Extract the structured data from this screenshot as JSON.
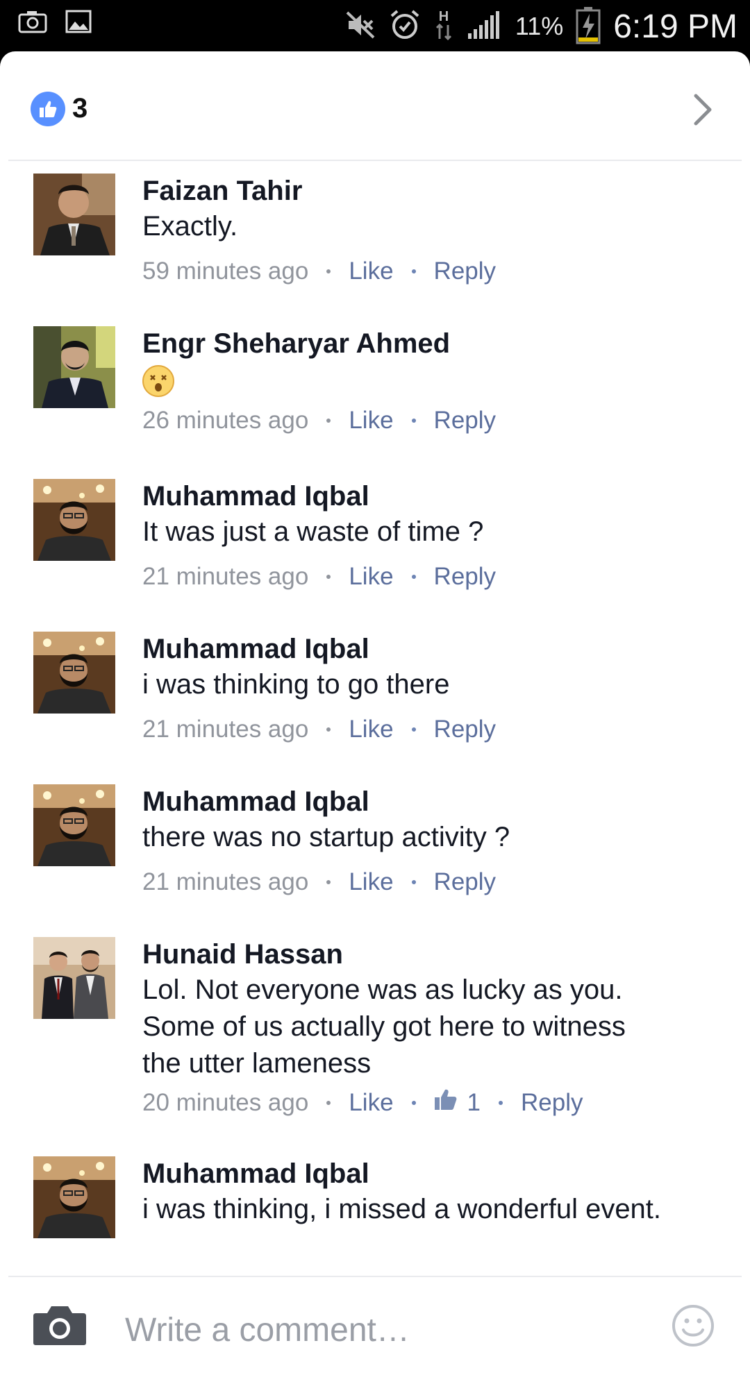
{
  "status_bar": {
    "left_icons": [
      "camera-icon",
      "gallery-icon"
    ],
    "right_icons": [
      "mute-icon",
      "alarm-icon",
      "hspa-data-icon",
      "signal-icon",
      "battery-charging-icon"
    ],
    "battery_pct": "11%",
    "time": "6:19 PM"
  },
  "likes": {
    "icon": "thumbs-up-icon",
    "count": "3",
    "accent": "#5890ff"
  },
  "comments": [
    {
      "name": "Faizan Tahir",
      "text": "Exactly.",
      "time": "59 minutes ago",
      "like": "Like",
      "reply": "Reply"
    },
    {
      "name": "Engr Sheharyar Ahmed",
      "emoji": "dizzy-face-emoji",
      "time": "26 minutes ago",
      "like": "Like",
      "reply": "Reply"
    },
    {
      "name": "Muhammad Iqbal",
      "text": "It was just a waste of time ?",
      "time": "21 minutes ago",
      "like": "Like",
      "reply": "Reply"
    },
    {
      "name": "Muhammad Iqbal",
      "text": "i was thinking to go there",
      "time": "21 minutes ago",
      "like": "Like",
      "reply": "Reply"
    },
    {
      "name": "Muhammad Iqbal",
      "text": "there was no startup activity ?",
      "time": "21 minutes ago",
      "like": "Like",
      "reply": "Reply"
    },
    {
      "name": "Hunaid Hassan",
      "text_lines": [
        "Lol. Not everyone was as lucky as you.",
        "Some of us actually got here to witness",
        "the utter lameness"
      ],
      "time": "20 minutes ago",
      "like": "Like",
      "like_count": "1",
      "reply": "Reply"
    },
    {
      "name": "Muhammad Iqbal",
      "text": "i was thinking, i missed a wonderful event."
    }
  ],
  "composer": {
    "camera_icon": "camera-icon",
    "placeholder": "Write a comment…",
    "smiley_icon": "smiley-icon"
  },
  "colors": {
    "link": "#5b6e9c",
    "meta": "#90949c",
    "name": "#141823"
  }
}
